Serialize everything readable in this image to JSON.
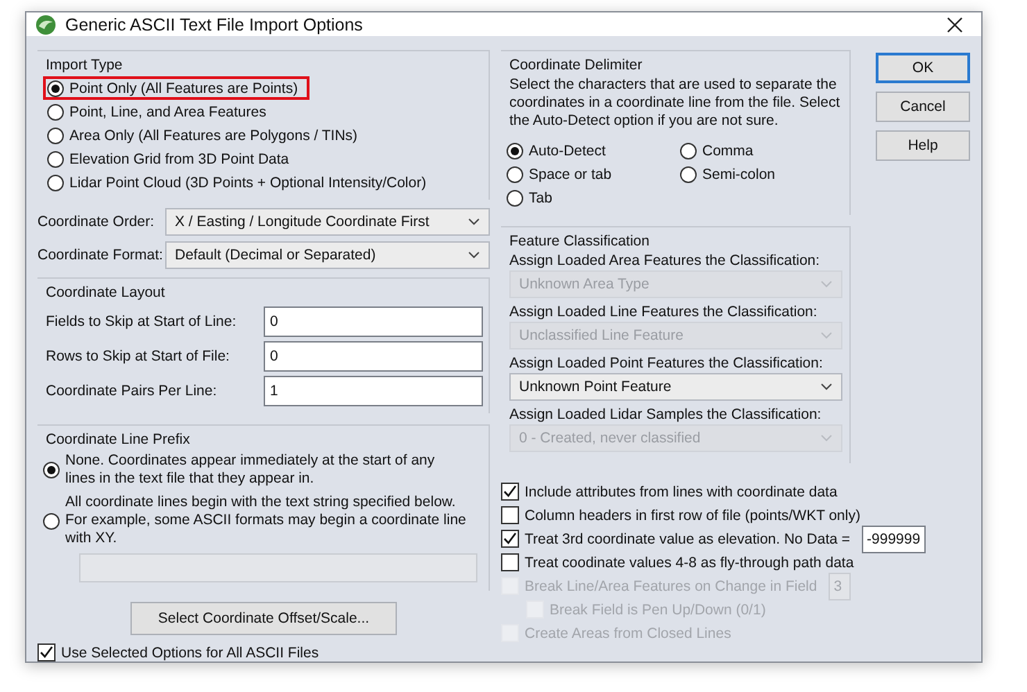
{
  "window": {
    "title": "Generic ASCII Text File Import Options"
  },
  "import_type": {
    "title": "Import Type",
    "options": [
      {
        "label": "Point Only (All Features are Points)",
        "selected": true,
        "highlighted": true
      },
      {
        "label": "Point, Line, and Area Features",
        "selected": false,
        "highlighted": false
      },
      {
        "label": "Area Only (All Features are Polygons / TINs)",
        "selected": false,
        "highlighted": false
      },
      {
        "label": "Elevation Grid from 3D Point Data",
        "selected": false,
        "highlighted": false
      },
      {
        "label": "Lidar Point Cloud (3D Points + Optional Intensity/Color)",
        "selected": false,
        "highlighted": false
      }
    ]
  },
  "coordinate_order": {
    "label": "Coordinate Order:",
    "value": "X / Easting / Longitude Coordinate First"
  },
  "coordinate_format": {
    "label": "Coordinate Format:",
    "value": "Default (Decimal or Separated)"
  },
  "coordinate_layout": {
    "title": "Coordinate Layout",
    "fields": [
      {
        "label": "Fields to Skip at Start of Line:",
        "value": "0"
      },
      {
        "label": "Rows to Skip at Start of File:",
        "value": "0"
      },
      {
        "label": "Coordinate Pairs Per Line:",
        "value": "1"
      }
    ]
  },
  "line_prefix": {
    "title": "Coordinate Line Prefix",
    "options": [
      {
        "label": "None. Coordinates appear immediately at the start of any lines in the text file that they appear in.",
        "selected": true
      },
      {
        "label": "All coordinate lines begin with the text string specified below. For example, some ASCII formats may begin a coordinate line with XY.",
        "selected": false
      }
    ]
  },
  "offset_button": {
    "label": "Select Coordinate Offset/Scale..."
  },
  "use_all": {
    "label": "Use Selected Options for All ASCII Files",
    "checked": true
  },
  "delimiter": {
    "title": "Coordinate Delimiter",
    "description": "Select the characters that are used to separate the coordinates in a coordinate line from the file. Select the Auto-Detect option if you are not sure.",
    "options": [
      {
        "label": "Auto-Detect",
        "selected": true
      },
      {
        "label": "Comma",
        "selected": false
      },
      {
        "label": "Space or tab",
        "selected": false
      },
      {
        "label": "Semi-colon",
        "selected": false
      },
      {
        "label": "Tab",
        "selected": false
      }
    ]
  },
  "classification": {
    "title": "Feature Classification",
    "rows": [
      {
        "label": "Assign Loaded Area Features the Classification:",
        "value": "Unknown Area Type",
        "disabled": true
      },
      {
        "label": "Assign Loaded Line Features the Classification:",
        "value": "Unclassified Line Feature",
        "disabled": true
      },
      {
        "label": "Assign Loaded Point Features the Classification:",
        "value": "Unknown Point Feature",
        "disabled": false
      },
      {
        "label": "Assign Loaded Lidar Samples the Classification:",
        "value": "0 - Created, never classified",
        "disabled": true
      }
    ]
  },
  "options": [
    {
      "label": "Include attributes from lines with coordinate data",
      "checked": true,
      "disabled": false
    },
    {
      "label": "Column headers in first row of file (points/WKT only)",
      "checked": false,
      "disabled": false
    },
    {
      "label": "Treat 3rd coordinate value as elevation. No Data =",
      "checked": true,
      "disabled": false,
      "value": "-999999"
    },
    {
      "label": "Treat coodinate values 4-8 as fly-through path data",
      "checked": false,
      "disabled": false
    },
    {
      "label": "Break Line/Area Features on Change in Field",
      "checked": false,
      "disabled": true,
      "value": "3",
      "children": [
        {
          "label": "Break Field is Pen Up/Down (0/1)",
          "checked": false,
          "disabled": true
        }
      ]
    },
    {
      "label": "Create Areas from Closed Lines",
      "checked": false,
      "disabled": true
    }
  ],
  "buttons": [
    {
      "label": "OK",
      "default": true
    },
    {
      "label": "Cancel",
      "default": false
    },
    {
      "label": "Help",
      "default": false
    }
  ]
}
